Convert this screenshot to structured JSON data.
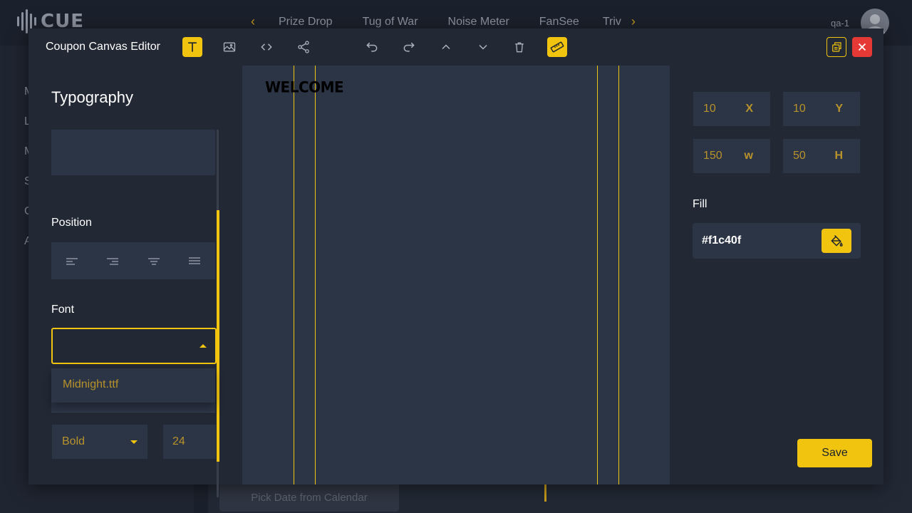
{
  "app": {
    "logo_text": "CUE",
    "nav_tabs": [
      "Prize Drop",
      "Tug of War",
      "Noise Meter",
      "FanSee",
      "Triv"
    ],
    "user_name": "qa-1",
    "sidebar_letters": [
      "M",
      "L",
      "M",
      "S",
      "C",
      "A"
    ],
    "background_button": "Pick Date from Calendar"
  },
  "modal": {
    "title": "Coupon Canvas Editor",
    "toolbar_icons": [
      "text-icon",
      "image-icon",
      "code-icon",
      "share-icon",
      "undo-icon",
      "redo-icon",
      "move-up-icon",
      "move-down-icon",
      "delete-icon",
      "ruler-icon"
    ],
    "accent_color": "#f1c40f",
    "close_color": "#e53935"
  },
  "typography": {
    "heading": "Typography",
    "position_label": "Position",
    "align_options": [
      "align-left-icon",
      "align-right-icon",
      "align-center-icon",
      "align-justify-icon"
    ],
    "font_label": "Font",
    "font_value": "",
    "font_options": [
      "Midnight.ttf"
    ],
    "weight_value": "Bold",
    "size_value": "24"
  },
  "canvas": {
    "text": "WELCOME",
    "background": "#2c3546"
  },
  "properties": {
    "x_value": "10",
    "x_label": "X",
    "y_value": "10",
    "y_label": "Y",
    "w_value": "150",
    "w_label": "w",
    "h_value": "50",
    "h_label": "H",
    "fill_label": "Fill",
    "fill_value": "#f1c40f",
    "save_label": "Save"
  }
}
